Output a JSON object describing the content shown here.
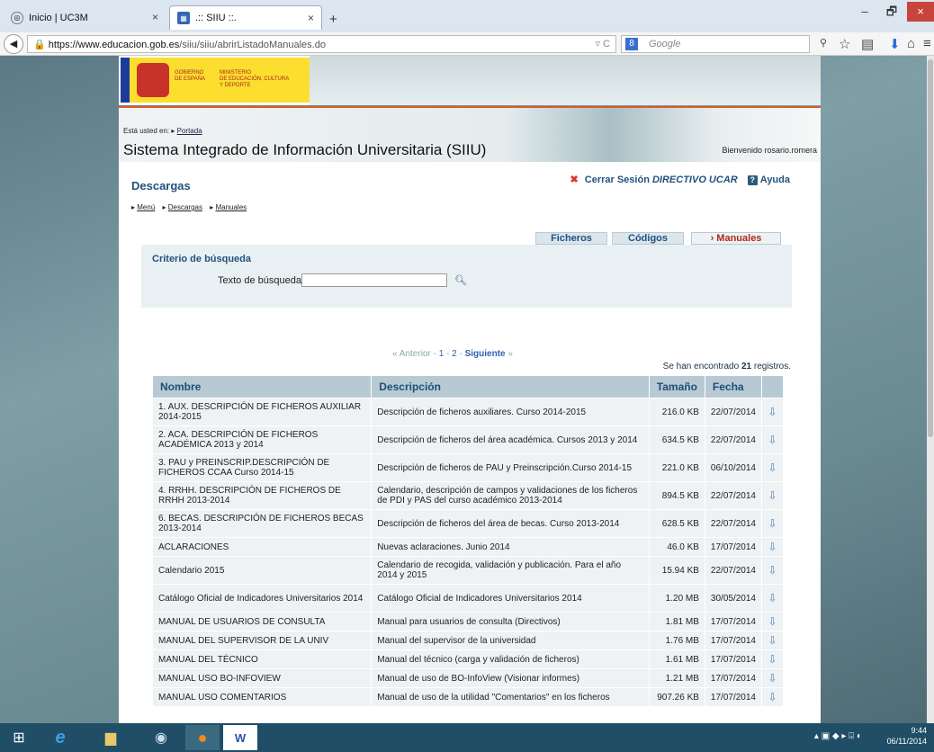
{
  "browser": {
    "tabs": [
      {
        "title": "Inicio | UC3M",
        "close": "×"
      },
      {
        "title": ".:: SIIU ::.",
        "close": "×"
      }
    ],
    "new_tab": "+",
    "window_controls": {
      "minimize": "–",
      "restore": "🗗",
      "close": "×"
    },
    "url_host": "https://www.educacion.gob.es",
    "url_path": "/siiu/siiu/abrirListadoManuales.do",
    "search_placeholder": "Google"
  },
  "gov": {
    "gobierno": "GOBIERNO\nDE ESPAÑA",
    "ministerio": "MINISTERIO\nDE EDUCACIÓN, CULTURA\nY DEPORTE"
  },
  "banner": {
    "here_label": "Está usted en:",
    "here_link": "Portada",
    "title": "Sistema Integrado de Información Universitaria (SIIU)",
    "welcome": "Bienvenido rosario.romera"
  },
  "page": {
    "heading": "Descargas",
    "crumbs": [
      "Menú",
      "Descargas",
      "Manuales"
    ],
    "logout": "Cerrar Sesión",
    "role": "DIRECTIVO UCAR",
    "help": "Ayuda",
    "tabs": [
      "Ficheros",
      "Códigos",
      "Manuales"
    ],
    "criteria_title": "Criterio de búsqueda",
    "search_label": "Texto de búsqueda:",
    "pager": {
      "prev": "Anterior",
      "pages": [
        "1",
        "2"
      ],
      "next": "Siguiente"
    },
    "count_prefix": "Se han encontrado",
    "count": "21",
    "count_suffix": "registros."
  },
  "table": {
    "headers": [
      "Nombre",
      "Descripción",
      "Tamaño",
      "Fecha"
    ],
    "rows": [
      {
        "name": "1. AUX. DESCRIPCIÓN DE FICHEROS AUXILIAR 2014-2015",
        "desc": "Descripción de ficheros auxiliares. Curso 2014-2015",
        "size": "216.0 KB",
        "date": "22/07/2014"
      },
      {
        "name": "2. ACA. DESCRIPCIÓN DE FICHEROS ACADÉMICA 2013 y 2014",
        "desc": "Descripción de ficheros del área académica. Cursos 2013 y 2014",
        "size": "634.5 KB",
        "date": "22/07/2014"
      },
      {
        "name": "3. PAU y PREINSCRIP.DESCRIPCIÓN DE FICHEROS CCAA Curso 2014-15",
        "desc": "Descripción de ficheros de PAU y Preinscripción.Curso 2014-15",
        "size": "221.0 KB",
        "date": "06/10/2014"
      },
      {
        "name": "4. RRHH. DESCRIPCIÓN DE FICHEROS DE RRHH 2013-2014",
        "desc": "Calendario, descripción de campos y validaciones de los ficheros de PDI y PAS del curso académico 2013-2014",
        "size": "894.5 KB",
        "date": "22/07/2014"
      },
      {
        "name": "6. BECAS. DESCRIPCIÓN DE FICHEROS BECAS 2013-2014",
        "desc": "Descripción de ficheros del área de becas. Curso 2013-2014",
        "size": "628.5 KB",
        "date": "22/07/2014"
      },
      {
        "name": "ACLARACIONES",
        "desc": "Nuevas aclaraciones. Junio 2014",
        "size": "46.0 KB",
        "date": "17/07/2014"
      },
      {
        "name": "Calendario 2015",
        "desc": "Calendario de recogida, validación y publicación. Para el año 2014 y 2015",
        "size": "15.94 KB",
        "date": "22/07/2014"
      },
      {
        "name": "Catálogo Oficial de Indicadores Universitarios 2014",
        "desc": "Catálogo Oficial de Indicadores Universitarios 2014",
        "size": "1.20 MB",
        "date": "30/05/2014"
      },
      {
        "name": "MANUAL DE USUARIOS DE CONSULTA",
        "desc": "Manual para usuarios de consulta (Directivos)",
        "size": "1.81 MB",
        "date": "17/07/2014"
      },
      {
        "name": "MANUAL DEL SUPERVISOR DE LA UNIV",
        "desc": "Manual del supervisor de la universidad",
        "size": "1.76 MB",
        "date": "17/07/2014"
      },
      {
        "name": "MANUAL DEL TÉCNICO",
        "desc": "Manual del técnico (carga y validación de ficheros)",
        "size": "1.61 MB",
        "date": "17/07/2014"
      },
      {
        "name": "MANUAL USO BO-INFOVIEW",
        "desc": "Manual de uso de BO-InfoView (Visionar informes)",
        "size": "1.21 MB",
        "date": "17/07/2014"
      },
      {
        "name": "MANUAL USO COMENTARIOS",
        "desc": "Manual de uso de la utilidad \"Comentarios\" en los ficheros",
        "size": "907.26 KB",
        "date": "17/07/2014"
      }
    ]
  },
  "taskbar": {
    "time": "9:44",
    "date": "06/11/2014"
  }
}
